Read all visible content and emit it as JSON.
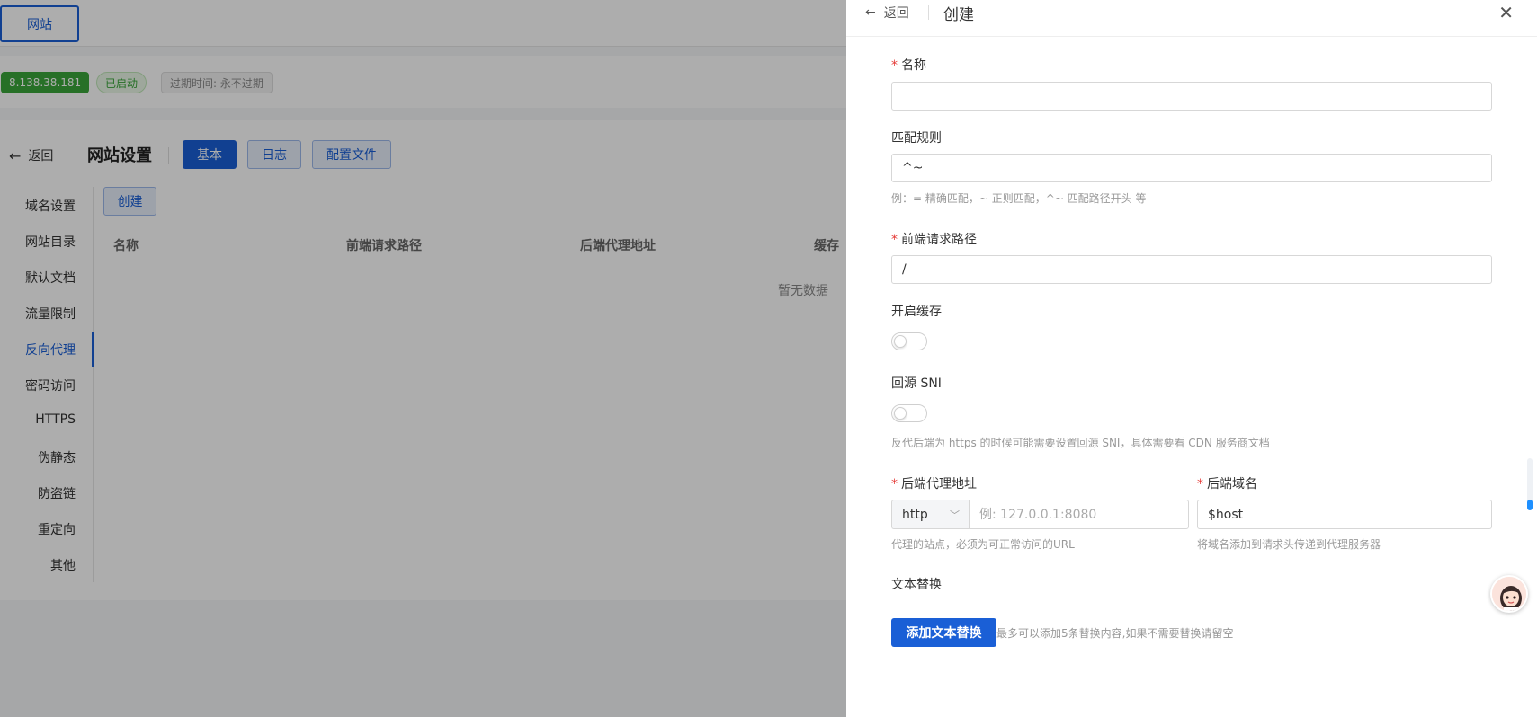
{
  "background": {
    "site_tab": "网站",
    "badges": {
      "ip": "8.138.38.181",
      "status": "已启动",
      "expire": "过期时间: 永不过期"
    },
    "back_label": "返回",
    "page_title": "网站设置",
    "seg_tabs": [
      "基本",
      "日志",
      "配置文件"
    ],
    "side_menu": [
      "域名设置",
      "网站目录",
      "默认文档",
      "流量限制",
      "反向代理",
      "密码访问",
      "HTTPS",
      "伪静态",
      "防盗链",
      "重定向",
      "其他"
    ],
    "active_menu": "反向代理",
    "create_button": "创建",
    "table_columns": [
      "名称",
      "前端请求路径",
      "后端代理地址",
      "缓存"
    ],
    "empty_text": "暂无数据"
  },
  "drawer": {
    "back_label": "返回",
    "title": "创建",
    "fields": {
      "name": {
        "label": "名称",
        "value": ""
      },
      "match": {
        "label": "匹配规则",
        "value": "^~",
        "hint": "例：= 精确匹配，~ 正则匹配，^~ 匹配路径开头 等"
      },
      "path": {
        "label": "前端请求路径",
        "value": "/"
      },
      "cache": {
        "label": "开启缓存",
        "enabled": false
      },
      "sni": {
        "label": "回源 SNI",
        "enabled": false,
        "hint": "反代后端为 https 的时候可能需要设置回源 SNI，具体需要看 CDN 服务商文档"
      },
      "backend": {
        "label": "后端代理地址",
        "protocol": "http",
        "placeholder": "例: 127.0.0.1:8080",
        "hint": "代理的站点，必须为可正常访问的URL"
      },
      "domain": {
        "label": "后端域名",
        "value": "$host",
        "hint": "将域名添加到请求头传递到代理服务器"
      },
      "replace": {
        "label": "文本替换",
        "button": "添加文本替换",
        "hint": "最多可以添加5条替换内容,如果不需要替换请留空"
      }
    }
  },
  "colors": {
    "primary": "#1a5fd6",
    "success": "#3aa53a",
    "required": "#e53935"
  }
}
